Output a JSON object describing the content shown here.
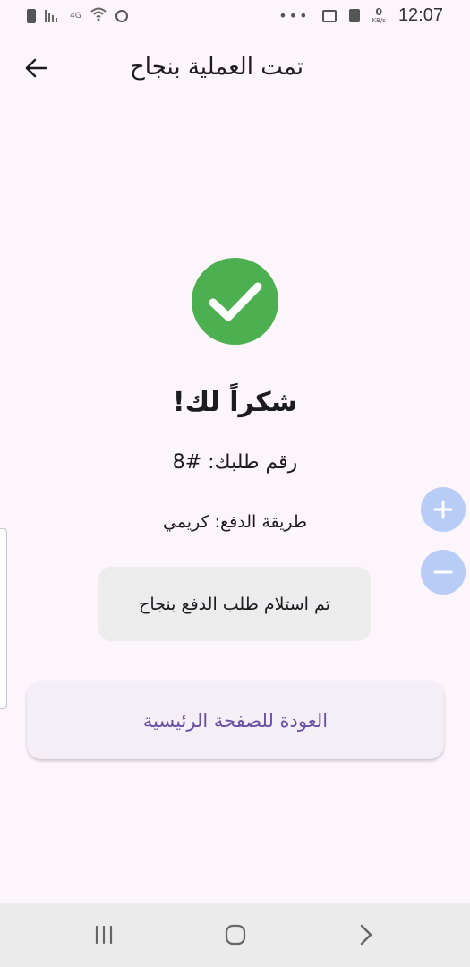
{
  "status_bar": {
    "network_label": "4G",
    "time": "12:07",
    "data_speed_value": "0",
    "data_speed_unit": "KB/s",
    "icons": [
      "battery-icon",
      "signal-icon",
      "wifi-icon",
      "alarm-icon",
      "more-dots-icon",
      "gallery-icon",
      "sim-card-icon"
    ]
  },
  "app_bar": {
    "title": "تمت العملية بنجاح",
    "back_icon": "arrow-left-icon"
  },
  "content": {
    "success_icon": "check-circle-icon",
    "success_color": "#4caf50",
    "thanks_text": "شكراً لك!",
    "order_number_text": "رقم طلبك: #8",
    "payment_method_text": "طريقة الدفع: كريمي",
    "status_message": "تم استلام طلب الدفع بنجاح",
    "home_button_label": "العودة للصفحة الرئيسية",
    "accent_color": "#6a4fa6"
  },
  "zoom_controls": {
    "zoom_in_icon": "plus-icon",
    "zoom_out_icon": "minus-icon",
    "color": "#b8ccf8"
  },
  "nav_bar": {
    "recents_icon": "recents-icon",
    "home_icon": "home-icon",
    "back_icon": "chevron-right-icon"
  }
}
